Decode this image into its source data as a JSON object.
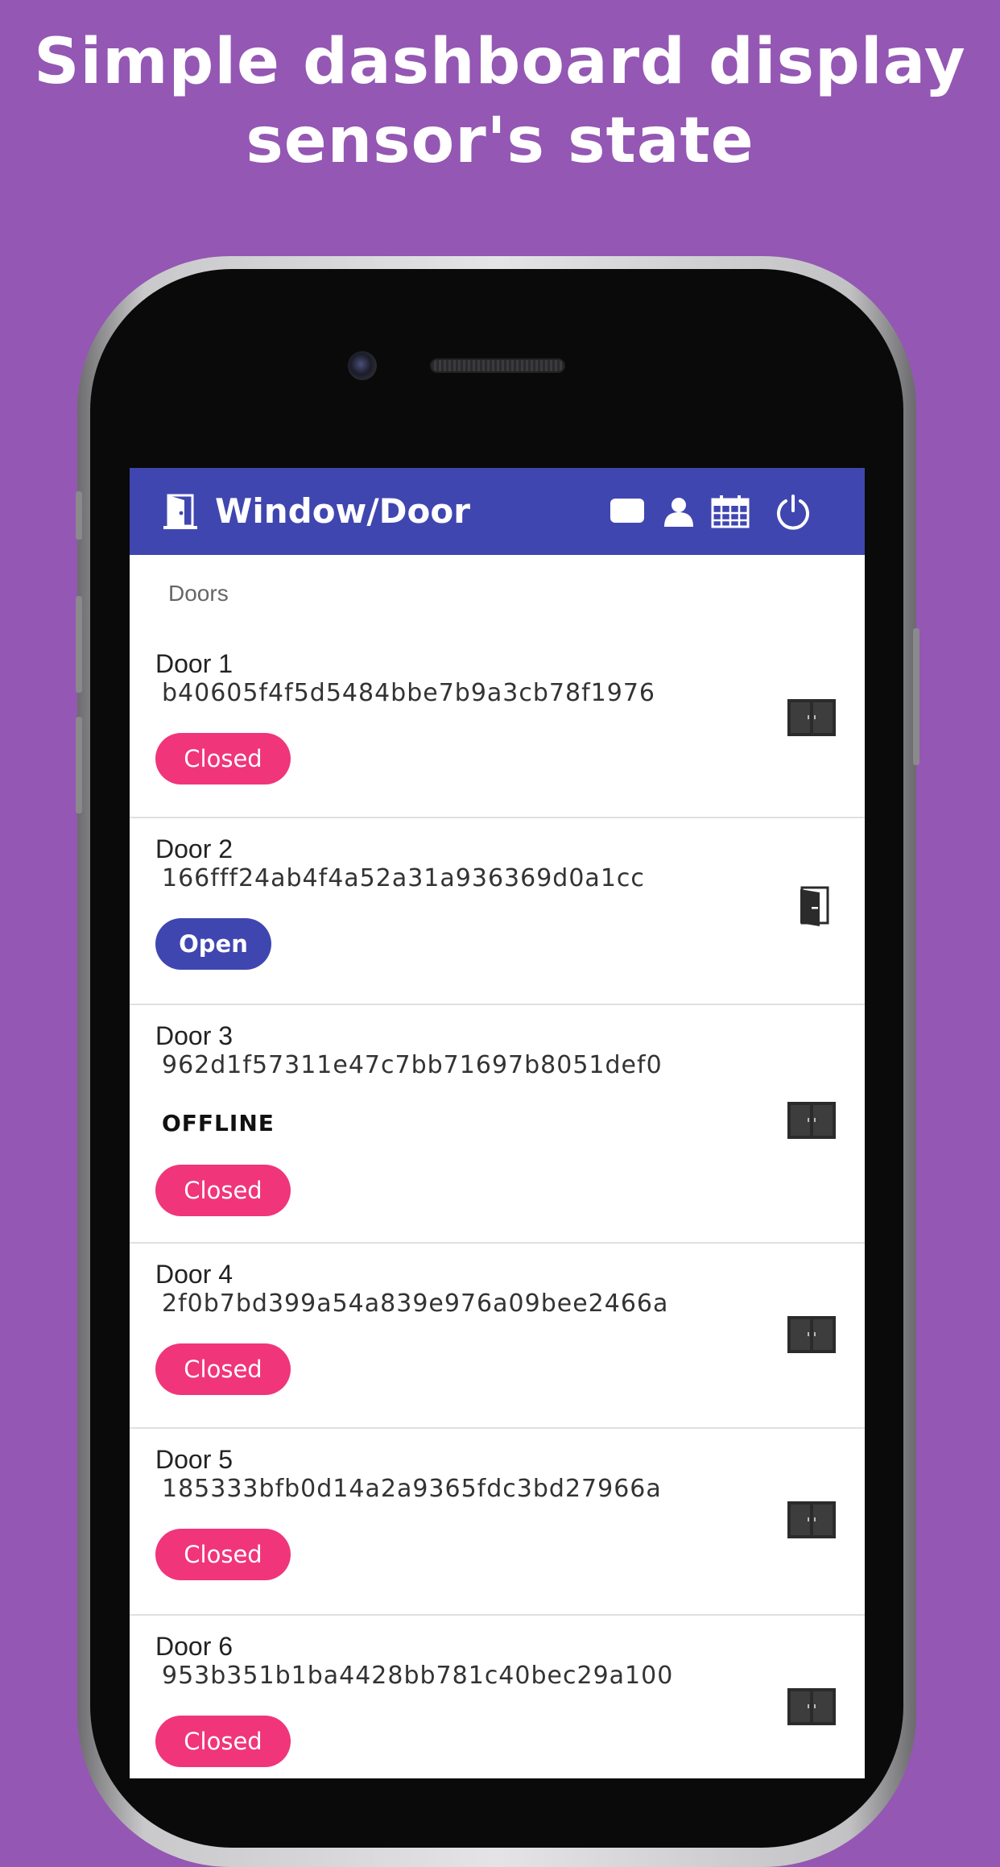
{
  "promo": {
    "title_line1": "Simple dashboard display",
    "title_line2": "sensor's state"
  },
  "appbar": {
    "title": "Window/Door",
    "icons": [
      "door-icon",
      "message-icon",
      "user-icon",
      "calendar-icon",
      "power-icon"
    ]
  },
  "section": {
    "label": "Doors"
  },
  "doors": [
    {
      "name": "Door 1",
      "id": "b40605f4f5d5484bbe7b9a3cb78f1976",
      "offline": "",
      "status": "Closed",
      "icon": "double-door-closed-icon"
    },
    {
      "name": "Door 2",
      "id": "166fff24ab4f4a52a31a936369d0a1cc",
      "offline": "",
      "status": "Open",
      "icon": "door-open-icon"
    },
    {
      "name": "Door 3",
      "id": "962d1f57311e47c7bb71697b8051def0",
      "offline": "OFFLINE",
      "status": "Closed",
      "icon": "double-door-closed-icon"
    },
    {
      "name": "Door 4",
      "id": "2f0b7bd399a54a839e976a09bee2466a",
      "offline": "",
      "status": "Closed",
      "icon": "double-door-closed-icon"
    },
    {
      "name": "Door 5",
      "id": "185333bfb0d14a2a9365fdc3bd27966a",
      "offline": "",
      "status": "Closed",
      "icon": "double-door-closed-icon"
    },
    {
      "name": "Door 6",
      "id": "953b351b1ba4428bb781c40bec29a100",
      "offline": "",
      "status": "Closed",
      "icon": "double-door-closed-icon"
    }
  ],
  "colors": {
    "background": "#9457b3",
    "appbar": "#4046b0",
    "closed_chip": "#f0357a",
    "open_chip": "#4046b0"
  }
}
